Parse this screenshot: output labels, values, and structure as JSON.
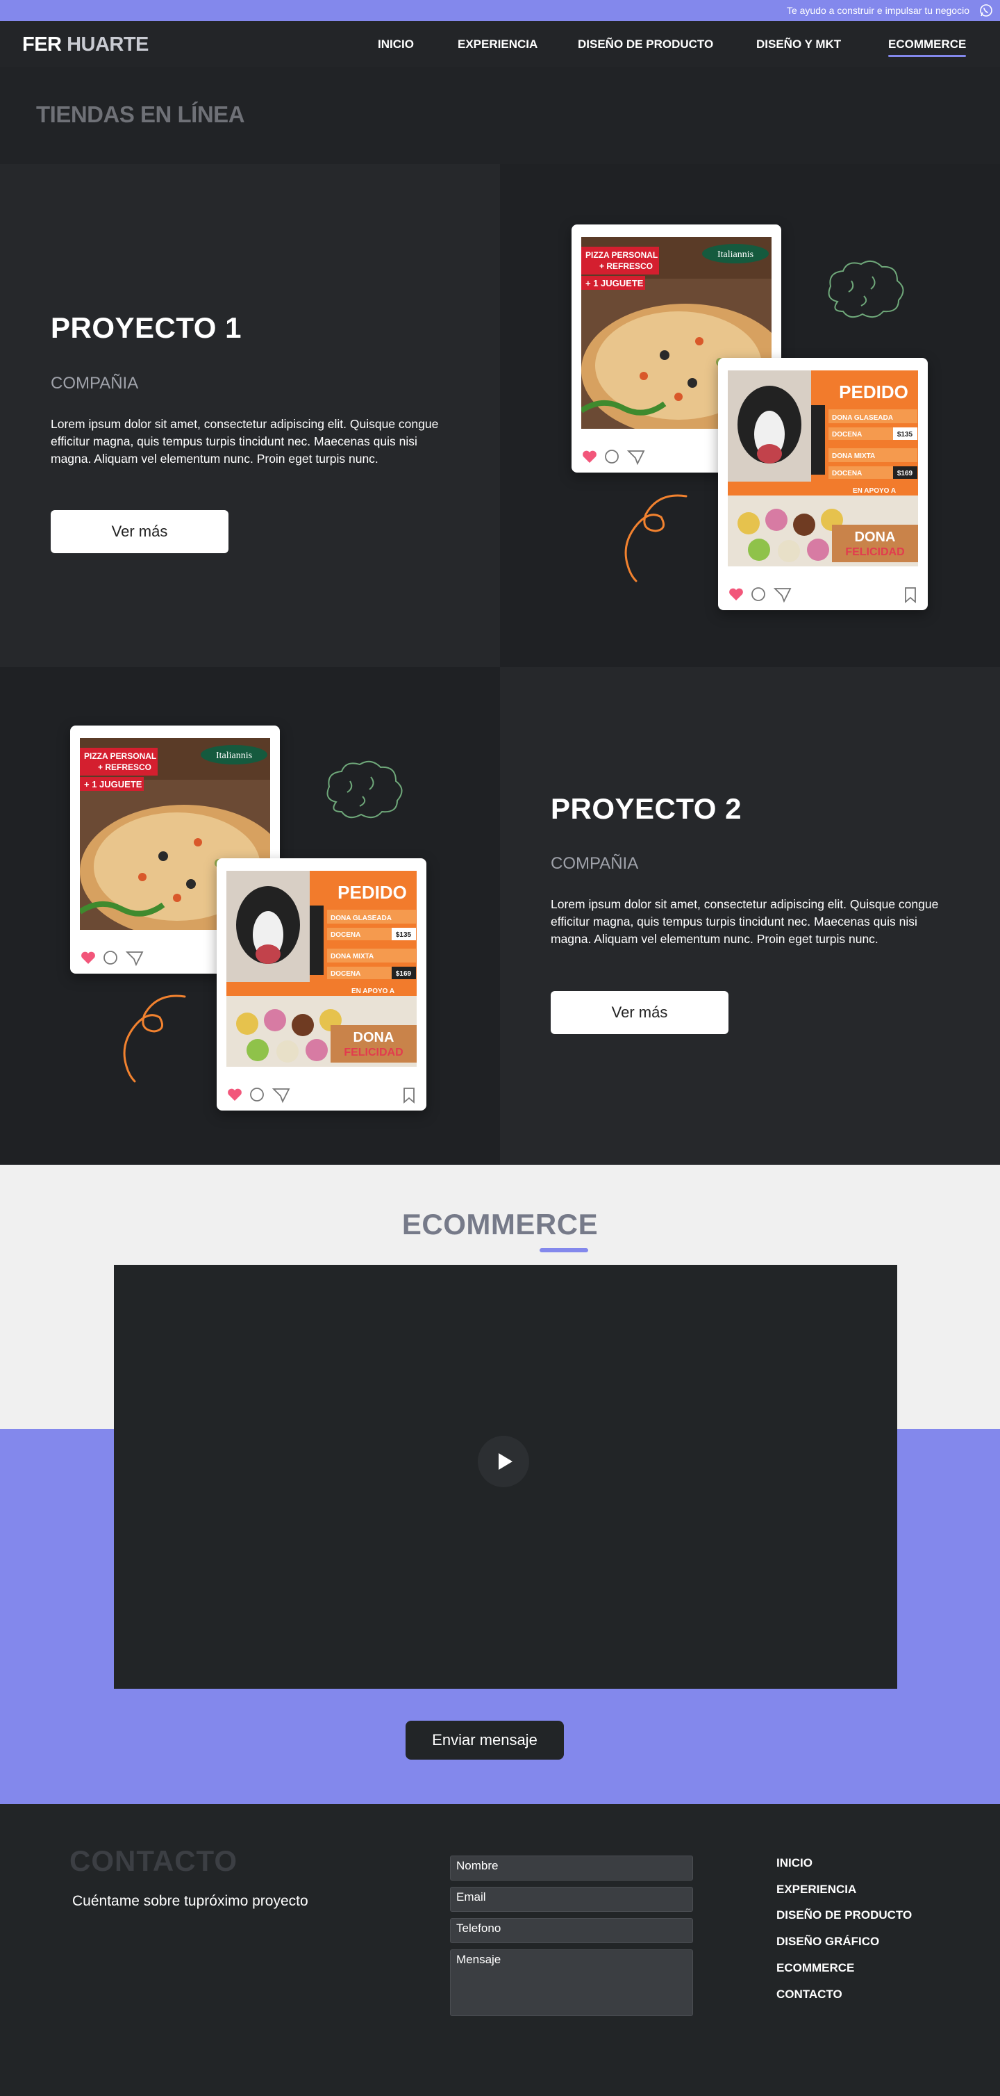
{
  "topbar": {
    "tagline": "Te ayudo a construir e impulsar tu negocio"
  },
  "brand": {
    "first": "FER",
    "last": "HUARTE"
  },
  "nav": [
    {
      "label": "INICIO"
    },
    {
      "label": "EXPERIENCIA"
    },
    {
      "label": "DISEÑO DE PRODUCTO"
    },
    {
      "label": "DISEÑO Y MKT"
    },
    {
      "label": "ECOMMERCE",
      "active": true
    }
  ],
  "hero": {
    "title": "TIENDAS EN LÍNEA"
  },
  "projects": [
    {
      "title": "PROYECTO 1",
      "company": "COMPAÑIA",
      "description": "Lorem ipsum dolor sit amet, consectetur adipiscing elit. Quisque congue efficitur magna, quis tempus turpis tincidunt nec. Maecenas quis nisi magna. Aliquam vel elementum nunc. Proin eget turpis nunc.",
      "button": "Ver más"
    },
    {
      "title": "PROYECTO 2",
      "company": "COMPAÑIA",
      "description": "Lorem ipsum dolor sit amet, consectetur adipiscing elit. Quisque congue efficitur magna, quis tempus turpis tincidunt nec. Maecenas quis nisi magna. Aliquam vel elementum nunc. Proin eget turpis nunc.",
      "button": "Ver más"
    }
  ],
  "mockups": {
    "pizza": {
      "badge_line1": "PIZZA PERSONAL",
      "badge_line2": "+ REFRESCO",
      "badge_line3": "+ 1 JUGUETE",
      "brand": "Italiannis"
    },
    "donut": {
      "heading": "PEDIDO",
      "row1": "DONA GLASEADA",
      "row2": "DOCENA",
      "price1": "$135",
      "row3": "DONA MIXTA",
      "row4": "DOCENA",
      "price2": "$169",
      "support": "EN APOYO A",
      "footer1": "DONA",
      "footer2": "FELICIDAD"
    }
  },
  "ecommerce": {
    "title": "ECOMMERCE",
    "send_button": "Enviar mensaje"
  },
  "contact": {
    "title": "CONTACTO",
    "subtitle": "Cuéntame sobre tupróximo proyecto",
    "fields": {
      "name": "Nombre",
      "email": "Email",
      "phone": "Telefono",
      "message": "Mensaje"
    }
  },
  "footer_links": [
    {
      "label": "INICIO"
    },
    {
      "label": "EXPERIENCIA"
    },
    {
      "label": "DISEÑO DE PRODUCTO"
    },
    {
      "label": "DISEÑO GRÁFICO"
    },
    {
      "label": "ECOMMERCE"
    },
    {
      "label": "CONTACTO"
    }
  ],
  "colors": {
    "accent": "#8388ec",
    "dark": "#222527",
    "panel_light": "#26282b",
    "panel_dark": "#1e2023",
    "heart": "#f2567a",
    "orange": "#f2822f"
  }
}
